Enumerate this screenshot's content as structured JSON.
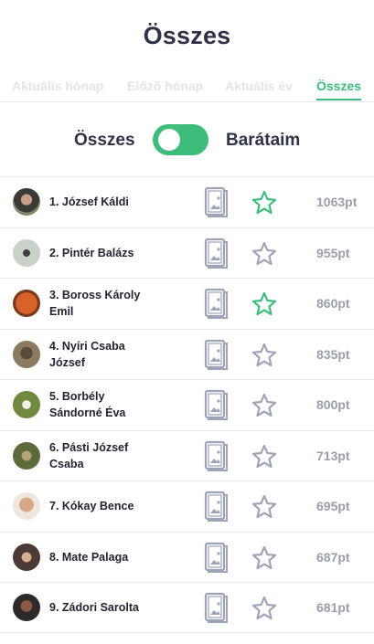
{
  "page": {
    "title": "Összes"
  },
  "tabs": [
    {
      "label": "Aktuális hónap"
    },
    {
      "label": "Előző hónap"
    },
    {
      "label": "Aktuális év"
    },
    {
      "label": "Összes"
    }
  ],
  "active_tab": "Összes",
  "toggle": {
    "left_label": "Összes",
    "right_label": "Barátaim",
    "state": "on",
    "color": "#3ebc7a"
  },
  "colors": {
    "accent": "#3ebc7a",
    "star_outline": "#9ea4b8",
    "icon_gray": "#9ea4b8"
  },
  "leaderboard": [
    {
      "name": "1. József Káldi",
      "points": "1063pt",
      "starred": true
    },
    {
      "name": "2. Pintér Balázs",
      "points": "955pt",
      "starred": false
    },
    {
      "name": "3. Boross Károly Emil",
      "points": "860pt",
      "starred": true
    },
    {
      "name": "4. Nyíri Csaba József",
      "points": "835pt",
      "starred": false
    },
    {
      "name": "5. Borbély Sándorné Éva",
      "points": "800pt",
      "starred": false
    },
    {
      "name": "6. Pásti József Csaba",
      "points": "713pt",
      "starred": false
    },
    {
      "name": "7. Kókay Bence",
      "points": "695pt",
      "starred": false
    },
    {
      "name": "8. Mate Palaga",
      "points": "687pt",
      "starred": false
    },
    {
      "name": "9. Zádori Sarolta",
      "points": "681pt",
      "starred": false
    }
  ]
}
